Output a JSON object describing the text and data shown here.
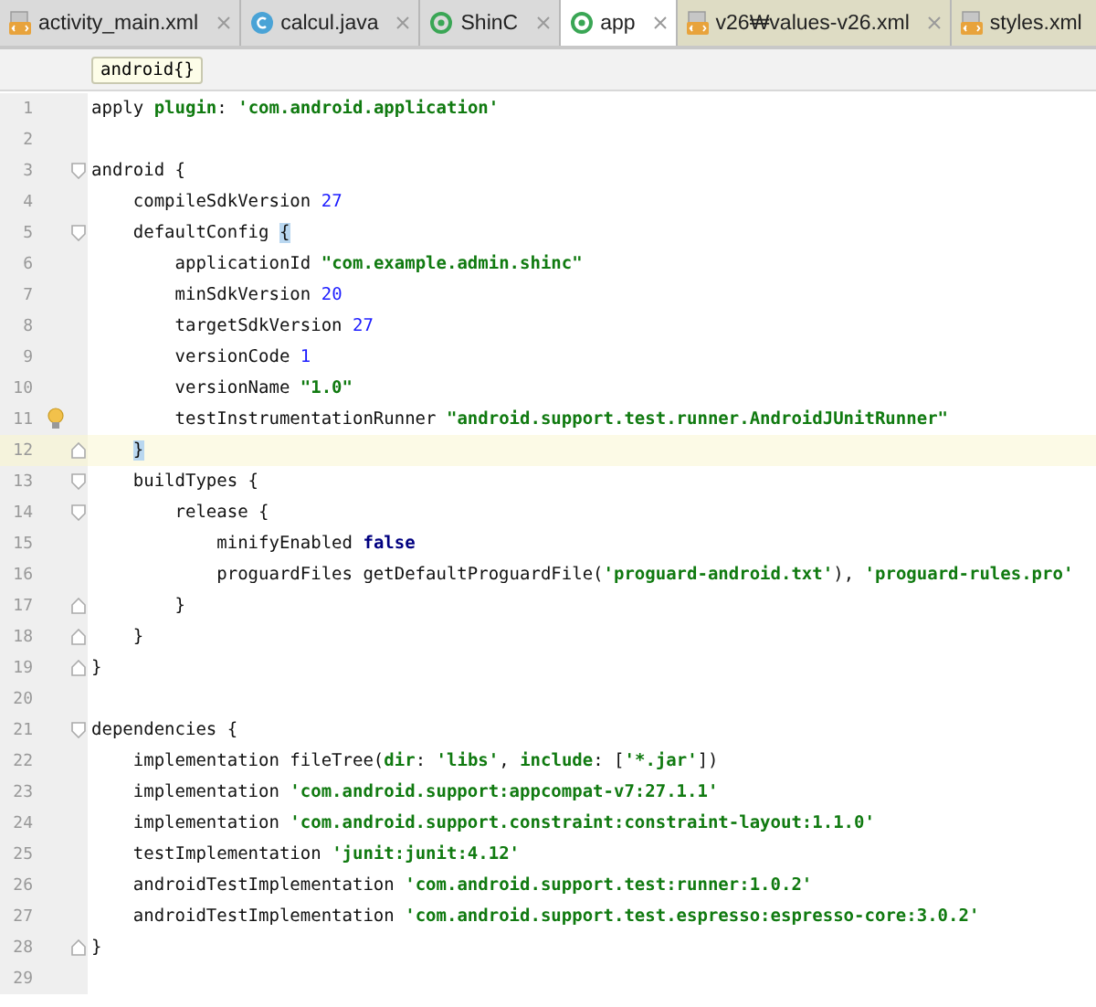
{
  "tabs": [
    {
      "label": "activity_main.xml",
      "kind": "xml",
      "tinted": false,
      "selected": false
    },
    {
      "label": "calcul.java",
      "kind": "class",
      "tinted": false,
      "selected": false
    },
    {
      "label": "ShinC",
      "kind": "module",
      "tinted": false,
      "selected": false
    },
    {
      "label": "app",
      "kind": "module",
      "tinted": false,
      "selected": true
    },
    {
      "label": "v26₩values-v26.xml",
      "kind": "xml",
      "tinted": true,
      "selected": false
    },
    {
      "label": "styles.xml",
      "kind": "xml",
      "tinted": true,
      "selected": false
    }
  ],
  "breadcrumb": "android{}",
  "lines": [
    {
      "number": "1",
      "tokens": [
        {
          "kind": "plain",
          "text": "apply "
        },
        {
          "kind": "string",
          "text": "plugin"
        },
        {
          "kind": "plain",
          "text": ": "
        },
        {
          "kind": "string",
          "text": "'com.android.application'"
        }
      ]
    },
    {
      "number": "2"
    },
    {
      "number": "3",
      "fold_start": true,
      "tokens": [
        {
          "kind": "plain",
          "text": "android {"
        }
      ]
    },
    {
      "number": "4",
      "tokens": [
        {
          "kind": "plain",
          "text": "    compileSdkVersion "
        },
        {
          "kind": "number",
          "text": "27"
        }
      ]
    },
    {
      "number": "5",
      "fold_start": true,
      "tokens": [
        {
          "kind": "plain",
          "text": "    defaultConfig "
        },
        {
          "kind": "brace",
          "text": "{"
        }
      ]
    },
    {
      "number": "6",
      "tokens": [
        {
          "kind": "plain",
          "text": "        applicationId "
        },
        {
          "kind": "string",
          "text": "\"com.example.admin.shinc\""
        }
      ]
    },
    {
      "number": "7",
      "tokens": [
        {
          "kind": "plain",
          "text": "        minSdkVersion "
        },
        {
          "kind": "number",
          "text": "20"
        }
      ]
    },
    {
      "number": "8",
      "tokens": [
        {
          "kind": "plain",
          "text": "        targetSdkVersion "
        },
        {
          "kind": "number",
          "text": "27"
        }
      ]
    },
    {
      "number": "9",
      "tokens": [
        {
          "kind": "plain",
          "text": "        versionCode "
        },
        {
          "kind": "number",
          "text": "1"
        }
      ]
    },
    {
      "number": "10",
      "tokens": [
        {
          "kind": "plain",
          "text": "        versionName "
        },
        {
          "kind": "string",
          "text": "\"1.0\""
        }
      ]
    },
    {
      "number": "11",
      "bulb": true,
      "tokens": [
        {
          "kind": "plain",
          "text": "        testInstrumentationRunner "
        },
        {
          "kind": "string",
          "text": "\"android.support.test.runner.AndroidJUnitRunner\""
        }
      ]
    },
    {
      "number": "12",
      "current": true,
      "fold_end": true,
      "tokens": [
        {
          "kind": "brace",
          "text": "    }"
        }
      ]
    },
    {
      "number": "13",
      "fold_start": true,
      "tokens": [
        {
          "kind": "plain",
          "text": "    buildTypes {"
        }
      ]
    },
    {
      "number": "14",
      "fold_start": true,
      "tokens": [
        {
          "kind": "plain",
          "text": "        release {"
        }
      ]
    },
    {
      "number": "15",
      "tokens": [
        {
          "kind": "plain",
          "text": "            minifyEnabled "
        },
        {
          "kind": "keyword",
          "text": "false"
        }
      ]
    },
    {
      "number": "16",
      "tokens": [
        {
          "kind": "plain",
          "text": "            proguardFiles getDefaultProguardFile("
        },
        {
          "kind": "string",
          "text": "'proguard-android.txt'"
        },
        {
          "kind": "plain",
          "text": "), "
        },
        {
          "kind": "string",
          "text": "'proguard-rules.pro'"
        }
      ]
    },
    {
      "number": "17",
      "fold_end": true,
      "tokens": [
        {
          "kind": "plain",
          "text": "        }"
        }
      ]
    },
    {
      "number": "18",
      "fold_end": true,
      "tokens": [
        {
          "kind": "plain",
          "text": "    }"
        }
      ]
    },
    {
      "number": "19",
      "fold_end": true,
      "tokens": [
        {
          "kind": "plain",
          "text": "}"
        }
      ]
    },
    {
      "number": "20"
    },
    {
      "number": "21",
      "fold_start": true,
      "tokens": [
        {
          "kind": "plain",
          "text": "dependencies {"
        }
      ]
    },
    {
      "number": "22",
      "tokens": [
        {
          "kind": "plain",
          "text": "    implementation fileTree("
        },
        {
          "kind": "string",
          "text": "dir"
        },
        {
          "kind": "plain",
          "text": ": "
        },
        {
          "kind": "string",
          "text": "'libs'"
        },
        {
          "kind": "plain",
          "text": ", "
        },
        {
          "kind": "string",
          "text": "include"
        },
        {
          "kind": "plain",
          "text": ": ["
        },
        {
          "kind": "string",
          "text": "'*.jar'"
        },
        {
          "kind": "plain",
          "text": "])"
        }
      ]
    },
    {
      "number": "23",
      "tokens": [
        {
          "kind": "plain",
          "text": "    implementation "
        },
        {
          "kind": "string",
          "text": "'com.android.support:appcompat-v7:27.1.1'"
        }
      ]
    },
    {
      "number": "24",
      "tokens": [
        {
          "kind": "plain",
          "text": "    implementation "
        },
        {
          "kind": "string",
          "text": "'com.android.support.constraint:constraint-layout:1.1.0'"
        }
      ]
    },
    {
      "number": "25",
      "tokens": [
        {
          "kind": "plain",
          "text": "    testImplementation "
        },
        {
          "kind": "string",
          "text": "'junit:junit:4.12'"
        }
      ]
    },
    {
      "number": "26",
      "tokens": [
        {
          "kind": "plain",
          "text": "    androidTestImplementation "
        },
        {
          "kind": "string",
          "text": "'com.android.support.test:runner:1.0.2'"
        }
      ]
    },
    {
      "number": "27",
      "tokens": [
        {
          "kind": "plain",
          "text": "    androidTestImplementation "
        },
        {
          "kind": "string",
          "text": "'com.android.support.test.espresso:espresso-core:3.0.2'"
        }
      ]
    },
    {
      "number": "28",
      "fold_end": true,
      "tokens": [
        {
          "kind": "plain",
          "text": "}"
        }
      ]
    },
    {
      "number": "29"
    }
  ]
}
